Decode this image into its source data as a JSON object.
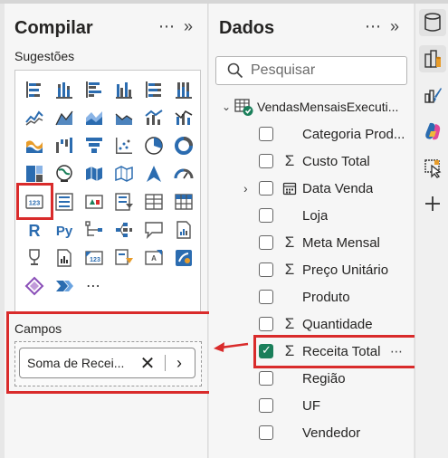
{
  "build_pane": {
    "title": "Compilar",
    "suggestions_label": "Sugestões",
    "fields_label": "Campos",
    "field_pill_text": "Soma de Recei..."
  },
  "data_pane": {
    "title": "Dados",
    "search_placeholder": "Pesquisar",
    "table_name": "VendasMensaisExecuti...",
    "fields": [
      {
        "name": "Categoria Prod...",
        "sigma": false,
        "checked": false
      },
      {
        "name": "Custo Total",
        "sigma": true,
        "checked": false
      },
      {
        "name": "Data Venda",
        "sigma": false,
        "checked": false,
        "date": true,
        "expandable": true
      },
      {
        "name": "Loja",
        "sigma": false,
        "checked": false
      },
      {
        "name": "Meta Mensal",
        "sigma": true,
        "checked": false
      },
      {
        "name": "Preço Unitário",
        "sigma": true,
        "checked": false
      },
      {
        "name": "Produto",
        "sigma": false,
        "checked": false
      },
      {
        "name": "Quantidade",
        "sigma": true,
        "checked": false
      },
      {
        "name": "Receita Total",
        "sigma": true,
        "checked": true
      },
      {
        "name": "Região",
        "sigma": false,
        "checked": false
      },
      {
        "name": "UF",
        "sigma": false,
        "checked": false
      },
      {
        "name": "Vendedor",
        "sigma": false,
        "checked": false
      }
    ]
  },
  "icons": {
    "pane_more": "more-icon",
    "pane_collapse": "double-chevron-right-icon",
    "search": "search-icon",
    "table": "table-icon",
    "rail": [
      "data-icon",
      "format-icon",
      "format-brush-icon",
      "copilot-icon",
      "select-icon",
      "add-icon"
    ]
  },
  "visuals": [
    "stacked-bar-chart",
    "stacked-column-chart",
    "clustered-bar-chart",
    "clustered-column-chart",
    "100-percent-bar-chart",
    "100-percent-column-chart",
    "line-chart",
    "area-chart",
    "stacked-area-chart",
    "area-chart-2",
    "line-clustered-column-chart",
    "line-stacked-column-chart",
    "ribbon-chart",
    "waterfall-chart",
    "funnel-chart",
    "scatter-chart",
    "pie-chart",
    "donut-chart",
    "treemap",
    "map",
    "filled-map",
    "shape-map",
    "azure-map",
    "gauge",
    "card",
    "multi-row-card",
    "kpi",
    "slicer",
    "table",
    "matrix",
    "r-visual",
    "python-visual",
    "key-influencers",
    "decomposition-tree",
    "qa-visual",
    "paginated-report",
    "goals",
    "smart-narrative",
    "card-new",
    "slicer-new",
    "metrics",
    "arcgis",
    "power-apps",
    "power-automate",
    "more-visuals"
  ],
  "colors": {
    "highlight": "#d92b2b",
    "checked": "#1a7f5a",
    "accent_blue": "#2b6cb0"
  }
}
